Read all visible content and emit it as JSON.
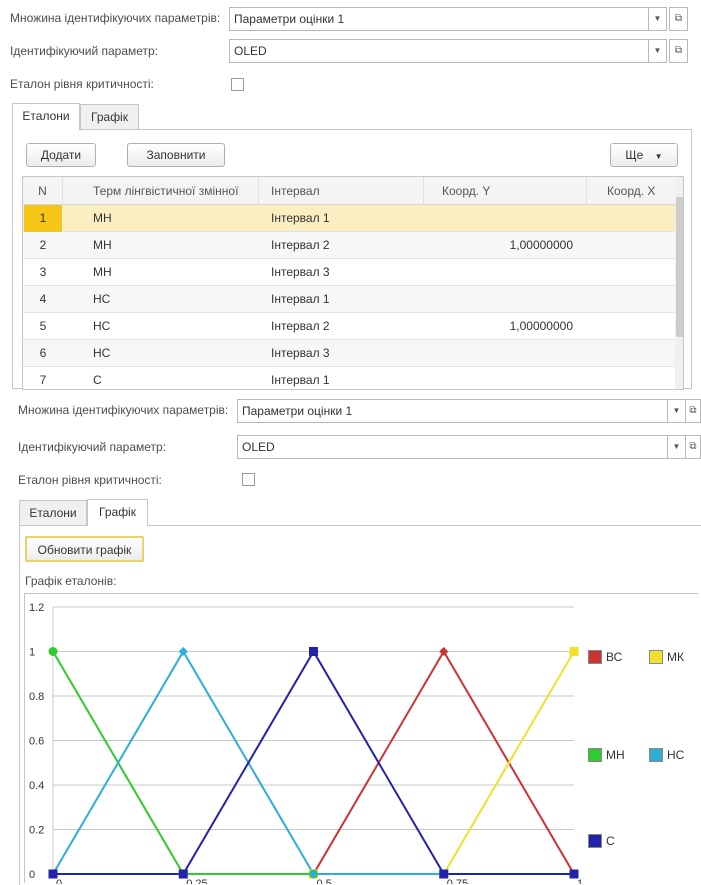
{
  "top": {
    "set_label": "Множина ідентифікуючих параметрів:",
    "set_value": "Параметри оцінки 1",
    "param_label": "Ідентифікуючий параметр:",
    "param_value": "OLED",
    "etalon_label": "Еталон рівня критичності:",
    "etalon_checked": false,
    "tabs": [
      {
        "label": "Еталони",
        "active": true
      },
      {
        "label": "Графік",
        "active": false
      }
    ],
    "buttons": {
      "add": "Додати",
      "fill": "Заповнити",
      "more": "Ще"
    },
    "table": {
      "columns": [
        "N",
        "Терм лінгвістичної змінної",
        "Інтервал",
        "Коорд. Y",
        "Коорд. X"
      ],
      "rows": [
        {
          "n": "1",
          "term": "МН",
          "interval": "Інтервал 1",
          "y": "",
          "selected": true
        },
        {
          "n": "2",
          "term": "МН",
          "interval": "Інтервал 2",
          "y": "1,00000000"
        },
        {
          "n": "3",
          "term": "МН",
          "interval": "Інтервал 3",
          "y": ""
        },
        {
          "n": "4",
          "term": "НС",
          "interval": "Інтервал 1",
          "y": ""
        },
        {
          "n": "5",
          "term": "НС",
          "interval": "Інтервал 2",
          "y": "1,00000000"
        },
        {
          "n": "6",
          "term": "НС",
          "interval": "Інтервал 3",
          "y": ""
        },
        {
          "n": "7",
          "term": "С",
          "interval": "Інтервал 1",
          "y": ""
        }
      ]
    }
  },
  "bottom": {
    "set_label": "Множина ідентифікуючих параметрів:",
    "set_value": "Параметри оцінки 1",
    "param_label": "Ідентифікуючий параметр:",
    "param_value": "OLED",
    "etalon_label": "Еталон рівня критичності:",
    "etalon_checked": false,
    "tabs": [
      {
        "label": "Еталони",
        "active": false
      },
      {
        "label": "Графік",
        "active": true
      }
    ],
    "refresh_button": "Обновити графік",
    "chart_caption": "Графік еталонів:"
  },
  "icons": {
    "dropdown": "triangle-down-icon",
    "open": "open-form-icon",
    "more_arrow": "triangle-down-icon"
  },
  "chart_data": {
    "type": "line",
    "title": "",
    "xlabel": "",
    "ylabel": "",
    "xlim": [
      0,
      1
    ],
    "ylim": [
      0,
      1.2
    ],
    "x_ticks": [
      "0",
      "0.25",
      "0.5",
      "0.75",
      "1"
    ],
    "y_ticks": [
      "0",
      "0.2",
      "0.4",
      "0.6",
      "0.8",
      "1",
      "1.2"
    ],
    "grid": true,
    "legend_position": "right",
    "series": [
      {
        "name": "ВС",
        "color": "#cc3333",
        "marker": "diamond",
        "points": [
          [
            0,
            0
          ],
          [
            0.25,
            0
          ],
          [
            0.5,
            0
          ],
          [
            0.75,
            1
          ],
          [
            1,
            0
          ]
        ]
      },
      {
        "name": "МК",
        "color": "#f2e12a",
        "marker": "square",
        "points": [
          [
            0,
            0
          ],
          [
            0.25,
            0
          ],
          [
            0.5,
            0
          ],
          [
            0.75,
            0
          ],
          [
            1,
            1
          ]
        ]
      },
      {
        "name": "МН",
        "color": "#2ecc2e",
        "marker": "circle",
        "points": [
          [
            0,
            1
          ],
          [
            0.25,
            0
          ],
          [
            0.5,
            0
          ],
          [
            0.75,
            0
          ],
          [
            1,
            0
          ]
        ]
      },
      {
        "name": "НС",
        "color": "#2eaed6",
        "marker": "diamond",
        "points": [
          [
            0,
            0
          ],
          [
            0.25,
            1
          ],
          [
            0.5,
            0
          ],
          [
            0.75,
            0
          ],
          [
            1,
            0
          ]
        ]
      },
      {
        "name": "С",
        "color": "#2222aa",
        "marker": "square",
        "points": [
          [
            0,
            0
          ],
          [
            0.25,
            0
          ],
          [
            0.5,
            1
          ],
          [
            0.75,
            0
          ],
          [
            1,
            0
          ]
        ]
      }
    ]
  }
}
